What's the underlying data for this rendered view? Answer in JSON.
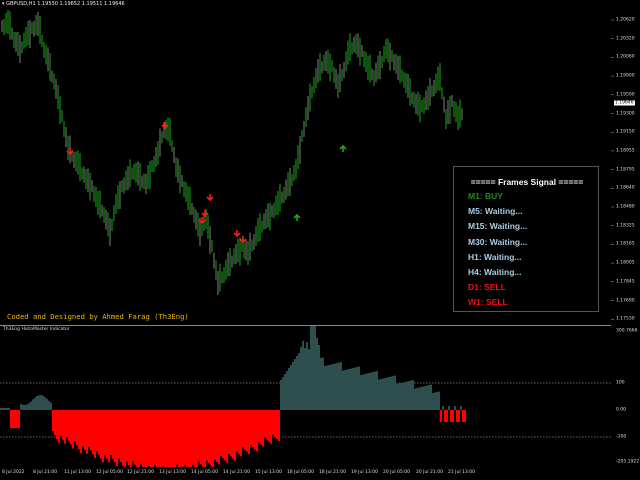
{
  "title_bar": "GBPUSD,H1   1.19530  1.19652  1.19511  1.19646",
  "price_axis": {
    "labels": [
      "1.20620",
      "1.20320",
      "1.20060",
      "1.19900",
      "1.19590",
      "1.19300",
      "1.19150",
      "1.18955",
      "1.18795",
      "1.18640",
      "1.18480",
      "1.18325",
      "1.18165",
      "1.18005",
      "1.17845",
      "1.17690",
      "1.17530"
    ],
    "current": "1.19646"
  },
  "signal_panel": {
    "title": "===== Frames Signal =====",
    "rows": [
      {
        "label": "M1: BUY",
        "color": "#1e8c1e"
      },
      {
        "label": "M5: Waiting...",
        "color": "#a9cde4"
      },
      {
        "label": "M15: Waiting...",
        "color": "#a9cde4"
      },
      {
        "label": "M30: Waiting...",
        "color": "#a9cde4"
      },
      {
        "label": "H1: Waiting...",
        "color": "#a9cde4"
      },
      {
        "label": "H4: Waiting...",
        "color": "#a9cde4"
      },
      {
        "label": "D1: SELL",
        "color": "#ee1111"
      },
      {
        "label": "W1: SELL",
        "color": "#ee1111"
      }
    ]
  },
  "credit_text": "Coded and Designed by Ahmed Farag (Th3Eng)",
  "indicator": {
    "title": "Th3Eng HistoMaster Indicator",
    "axis_labels": [
      "300.7666",
      "100",
      "0.00",
      "-100",
      "-205.1922"
    ],
    "positive_color": "#2f4f4f",
    "negative_color": "#ff0000",
    "level_line_color": "#cccccc"
  },
  "time_axis": [
    "8 Jul 2022",
    "8 Jul 21:00",
    "11 Jul 13:00",
    "12 Jul 05:00",
    "12 Jul 21:00",
    "13 Jul 13:00",
    "14 Jul 05:00",
    "14 Jul 21:00",
    "15 Jul 13:00",
    "18 Jul 05:00",
    "18 Jul 21:00",
    "19 Jul 13:00",
    "20 Jul 05:00",
    "20 Jul 21:00",
    "21 Jul 13:00"
  ],
  "colors": {
    "bull_candle": "#1fa41f",
    "bear_candle": "#808080",
    "sell_arrow": "#ff1a1a",
    "buy_arrow": "#1fa41f"
  },
  "icons": {
    "sell_arrow": "down-arrow-icon",
    "buy_arrow": "up-arrow-icon"
  }
}
